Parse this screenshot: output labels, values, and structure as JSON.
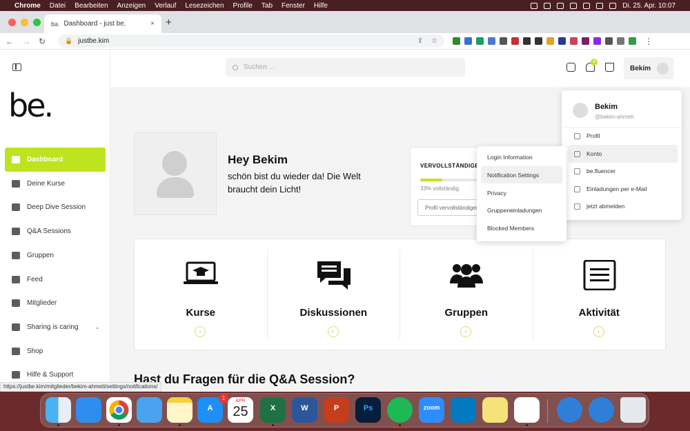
{
  "menubar": {
    "apple": "",
    "app": "Chrome",
    "items": [
      "Datei",
      "Bearbeiten",
      "Anzeigen",
      "Verlauf",
      "Lesezeichen",
      "Profile",
      "Tab",
      "Fenster",
      "Hilfe"
    ],
    "clock": "Di. 25. Apr.  10:07"
  },
  "browser": {
    "tab_title": "Dashboard - just be.",
    "tab_favicon": "bə.",
    "tab_close": "×",
    "new_tab": "+",
    "url": "justbe.kim",
    "back": "←",
    "forward": "→",
    "reload": "↻",
    "lock": "🔒",
    "share": "⇪",
    "star": "☆",
    "menu": "⋮"
  },
  "sidebar": {
    "logo": "be.",
    "items": [
      {
        "label": "Dashboard",
        "icon": "home-icon",
        "active": true
      },
      {
        "label": "Deine Kurse",
        "icon": "book-icon"
      },
      {
        "label": "Deep Dive Session",
        "icon": "star-icon"
      },
      {
        "label": "Q&A Sessions",
        "icon": "chat-icon"
      },
      {
        "label": "Gruppen",
        "icon": "group-icon"
      },
      {
        "label": "Feed",
        "icon": "feed-icon"
      },
      {
        "label": "Mitglieder",
        "icon": "members-icon"
      },
      {
        "label": "Sharing is caring",
        "icon": "heart-icon",
        "chevron": "⌄"
      },
      {
        "label": "Shop",
        "icon": "cart-icon"
      },
      {
        "label": "Hilfe & Support",
        "icon": "help-icon"
      }
    ]
  },
  "topbar": {
    "search_placeholder": "Suchen ...",
    "notif_count": "3",
    "username": "Bekim"
  },
  "hero": {
    "greeting": "Hey Bekim",
    "message": "schön bist du wieder da! Die Welt braucht dein Licht!"
  },
  "progress": {
    "title": "VERVOLLSTÄNDIGEN",
    "percent": 0.33,
    "percent_label": "33% vollständig",
    "button": "Profil vervollständigen"
  },
  "features": [
    {
      "label": "Kurse",
      "icon": "laptop-graduation-icon",
      "arrow": "›"
    },
    {
      "label": "Diskussionen",
      "icon": "discussion-icon",
      "arrow": "›"
    },
    {
      "label": "Gruppen",
      "icon": "group-icon",
      "arrow": "›"
    },
    {
      "label": "Aktivität",
      "icon": "activity-icon",
      "arrow": "›"
    }
  ],
  "qa_heading": "Hast du Fragen für die Q&A Session?",
  "account_menu": {
    "name": "Bekim",
    "handle": "@bekim-ahmeti",
    "items": [
      "Profil",
      "Konto",
      "be.fluencer",
      "Einladungen per e-Mail",
      "jetzt abmelden"
    ],
    "highlighted": "Konto"
  },
  "konto_submenu": {
    "items": [
      "Login Information",
      "Notification Settings",
      "Privacy",
      "Gruppeneinladungen",
      "Blocked Members"
    ],
    "highlighted": "Notification Settings"
  },
  "status_url": "https://justbe.kim/mitglieder/bekim-ahmeti/settings/notifications/",
  "dock": {
    "calendar_month": "APR",
    "calendar_day": "25",
    "appstore_badge": "1",
    "apps": [
      "Finder",
      "Safari",
      "Chrome",
      "Mail",
      "Notes",
      "App Store",
      "Calendar",
      "Excel",
      "Word",
      "PowerPoint",
      "Photoshop",
      "Spotify",
      "Zoom",
      "Trello",
      "Stickies",
      "Slack",
      "Globe",
      "Globe",
      "Trash"
    ]
  },
  "colors": {
    "accent": "#bde41f",
    "dark": "#111111"
  }
}
